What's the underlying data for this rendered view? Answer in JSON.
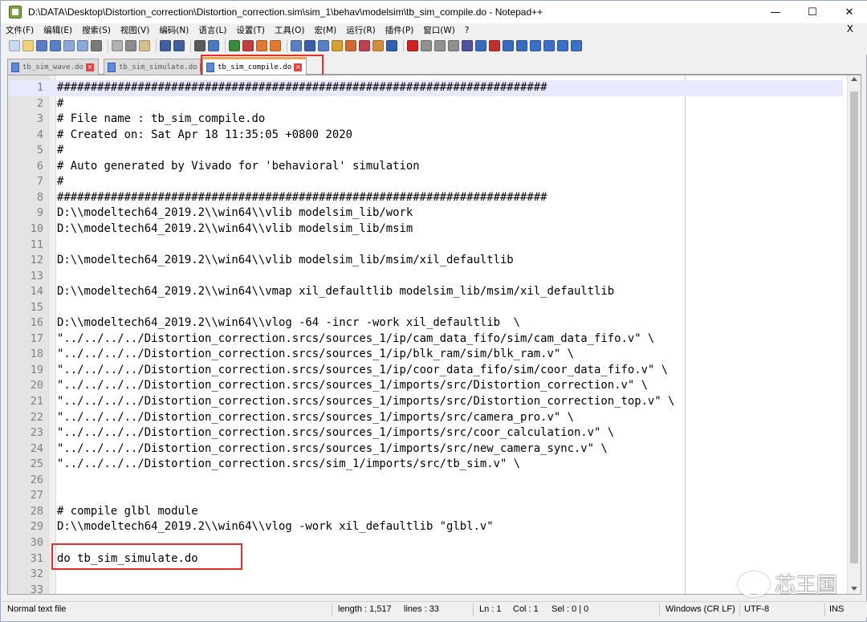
{
  "window": {
    "title": "D:\\DATA\\Desktop\\Distortion_correction\\Distortion_correction.sim\\sim_1\\behav\\modelsim\\tb_sim_compile.do - Notepad++",
    "minimize": "—",
    "maximize": "☐",
    "close": "✕"
  },
  "menu": {
    "items": [
      "文件(F)",
      "编辑(E)",
      "搜索(S)",
      "视图(V)",
      "编码(N)",
      "语言(L)",
      "设置(T)",
      "工具(O)",
      "宏(M)",
      "运行(R)",
      "插件(P)",
      "窗口(W)",
      "?"
    ],
    "close": "X"
  },
  "toolbar": {
    "icons": [
      "new-icon",
      "open-icon",
      "save-icon",
      "save-all-icon",
      "close-icon",
      "close-all-icon",
      "print-icon",
      "cut-icon",
      "copy-icon",
      "paste-icon",
      "undo-icon",
      "redo-icon",
      "find-icon",
      "replace-icon",
      "zoom-in-icon",
      "zoom-out-icon",
      "sync-v-icon",
      "sync-h-icon",
      "wrap-icon",
      "all-chars-icon",
      "indent-guide-icon",
      "udl-icon",
      "doc-map-icon",
      "function-list-icon",
      "folder-workspace-icon",
      "monitor-icon",
      "record-icon",
      "stop-icon",
      "play-icon",
      "run-multiple-icon",
      "save-macro-icon",
      "bookmark-icon",
      "compare-icon",
      "compare-prev-icon",
      "compare-next-icon",
      "up-icon",
      "down-icon",
      "first-icon",
      "last-icon"
    ]
  },
  "tabs": [
    {
      "label": "tb_sim_wave.do",
      "active": false
    },
    {
      "label": "tb_sim_simulate.do",
      "active": false
    },
    {
      "label": "tb_sim_compile.do",
      "active": true
    }
  ],
  "editor": {
    "current_line": 1,
    "lines": [
      {
        "n": "1",
        "text": "#########################################################################"
      },
      {
        "n": "2",
        "text": "#"
      },
      {
        "n": "3",
        "text": "# File name : tb_sim_compile.do"
      },
      {
        "n": "4",
        "text": "# Created on: Sat Apr 18 11:35:05 +0800 2020"
      },
      {
        "n": "5",
        "text": "#"
      },
      {
        "n": "6",
        "text": "# Auto generated by Vivado for 'behavioral' simulation"
      },
      {
        "n": "7",
        "text": "#"
      },
      {
        "n": "8",
        "text": "#########################################################################"
      },
      {
        "n": "9",
        "text": "D:\\\\modeltech64_2019.2\\\\win64\\\\vlib modelsim_lib/work"
      },
      {
        "n": "10",
        "text": "D:\\\\modeltech64_2019.2\\\\win64\\\\vlib modelsim_lib/msim"
      },
      {
        "n": "11",
        "text": ""
      },
      {
        "n": "12",
        "text": "D:\\\\modeltech64_2019.2\\\\win64\\\\vlib modelsim_lib/msim/xil_defaultlib"
      },
      {
        "n": "13",
        "text": ""
      },
      {
        "n": "14",
        "text": "D:\\\\modeltech64_2019.2\\\\win64\\\\vmap xil_defaultlib modelsim_lib/msim/xil_defaultlib"
      },
      {
        "n": "15",
        "text": ""
      },
      {
        "n": "16",
        "text": "D:\\\\modeltech64_2019.2\\\\win64\\\\vlog -64 -incr -work xil_defaultlib  \\"
      },
      {
        "n": "17",
        "text": "\"../../../../Distortion_correction.srcs/sources_1/ip/cam_data_fifo/sim/cam_data_fifo.v\" \\"
      },
      {
        "n": "18",
        "text": "\"../../../../Distortion_correction.srcs/sources_1/ip/blk_ram/sim/blk_ram.v\" \\"
      },
      {
        "n": "19",
        "text": "\"../../../../Distortion_correction.srcs/sources_1/ip/coor_data_fifo/sim/coor_data_fifo.v\" \\"
      },
      {
        "n": "20",
        "text": "\"../../../../Distortion_correction.srcs/sources_1/imports/src/Distortion_correction.v\" \\"
      },
      {
        "n": "21",
        "text": "\"../../../../Distortion_correction.srcs/sources_1/imports/src/Distortion_correction_top.v\" \\"
      },
      {
        "n": "22",
        "text": "\"../../../../Distortion_correction.srcs/sources_1/imports/src/camera_pro.v\" \\"
      },
      {
        "n": "23",
        "text": "\"../../../../Distortion_correction.srcs/sources_1/imports/src/coor_calculation.v\" \\"
      },
      {
        "n": "24",
        "text": "\"../../../../Distortion_correction.srcs/sources_1/imports/src/new_camera_sync.v\" \\"
      },
      {
        "n": "25",
        "text": "\"../../../../Distortion_correction.srcs/sim_1/imports/src/tb_sim.v\" \\"
      },
      {
        "n": "26",
        "text": ""
      },
      {
        "n": "27",
        "text": ""
      },
      {
        "n": "28",
        "text": "# compile glbl module"
      },
      {
        "n": "29",
        "text": "D:\\\\modeltech64_2019.2\\\\win64\\\\vlog -work xil_defaultlib \"glbl.v\""
      },
      {
        "n": "30",
        "text": ""
      },
      {
        "n": "31",
        "text": "do tb_sim_simulate.do"
      },
      {
        "n": "32",
        "text": ""
      },
      {
        "n": "33",
        "text": ""
      }
    ]
  },
  "status": {
    "file_type": "Normal text file",
    "length": "length : 1,517",
    "lines": "lines : 33",
    "ln": "Ln : 1",
    "col": "Col : 1",
    "sel": "Sel : 0 | 0",
    "eol": "Windows (CR LF)",
    "encoding": "UTF-8",
    "mode": "INS"
  },
  "watermark": {
    "text": "芯王国"
  },
  "colors": {
    "highlight_box": "#e03030",
    "active_tab_accent": "#f4a34a",
    "current_line": "#e8e8ff",
    "gutter": "#e4e4e4"
  }
}
